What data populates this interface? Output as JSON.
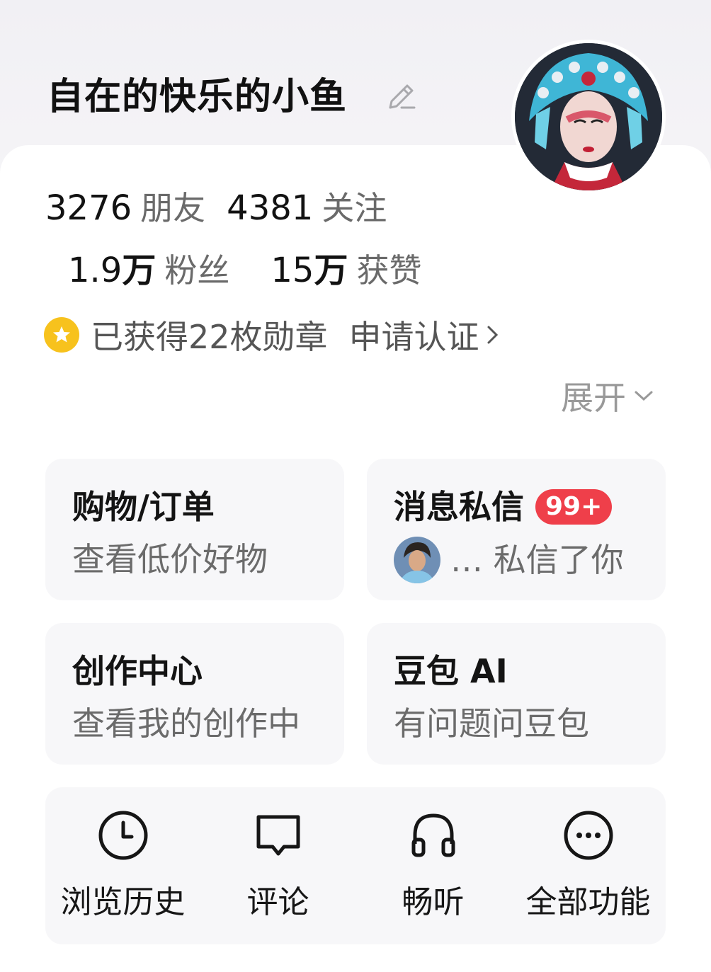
{
  "profile": {
    "username": "自在的快乐的小鱼"
  },
  "stats": {
    "friends": {
      "value": "3276",
      "label": "朋友"
    },
    "following": {
      "value": "4381",
      "label": "关注"
    },
    "fans": {
      "value_num": "1.9",
      "value_unit": "万",
      "label": "粉丝"
    },
    "likes": {
      "value_num": "15",
      "value_unit": "万",
      "label": "获赞"
    }
  },
  "badges": {
    "text": "已获得22枚勋章",
    "verify": "申请认证"
  },
  "expand_label": "展开",
  "tiles": {
    "shopping": {
      "title": "购物/订单",
      "subtitle": "查看低价好物"
    },
    "messages": {
      "title": "消息私信",
      "count": "99+",
      "preview": "… 私信了你"
    },
    "creator": {
      "title": "创作中心",
      "subtitle": "查看我的创作中"
    },
    "doubao": {
      "title": "豆包 AI",
      "subtitle": "有问题问豆包"
    }
  },
  "tools": [
    {
      "label": "浏览历史",
      "icon": "clock-icon"
    },
    {
      "label": "评论",
      "icon": "comment-icon"
    },
    {
      "label": "畅听",
      "icon": "headphones-icon"
    },
    {
      "label": "全部功能",
      "icon": "more-icon"
    }
  ],
  "colors": {
    "badge_red": "#ef3f4a",
    "medal_yellow": "#f7c21d",
    "tile_bg": "#f7f7f9"
  }
}
